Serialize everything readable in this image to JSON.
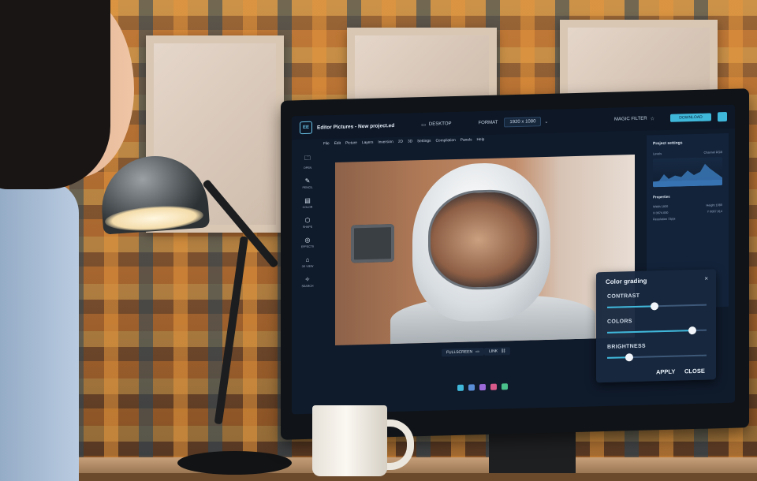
{
  "app": {
    "logo": "EE",
    "title": "Editor Pictures - New project.ed",
    "desktop_label": "DESKTOP",
    "format_label": "FORMAT",
    "format_value": "1920 x 1080",
    "magic_filter": "MAGIC FILTER",
    "download_label": "DOWNLOAD"
  },
  "menu": [
    "File",
    "Edit",
    "Picture",
    "Layers",
    "Inversion",
    "2D",
    "3D",
    "Settings",
    "Compilation",
    "Panels",
    "Help"
  ],
  "tools": [
    {
      "icon": "folder-icon",
      "glyph": "🗀",
      "label": "OPEN"
    },
    {
      "icon": "pencil-icon",
      "glyph": "✎",
      "label": "PENCIL"
    },
    {
      "icon": "palette-icon",
      "glyph": "▤",
      "label": "COLOR"
    },
    {
      "icon": "cube-icon",
      "glyph": "⬡",
      "label": "SHAPE"
    },
    {
      "icon": "glasses-icon",
      "glyph": "◎",
      "label": "EFFECTS"
    },
    {
      "icon": "home-icon",
      "glyph": "⌂",
      "label": "3D VIEW"
    },
    {
      "icon": "compass-icon",
      "glyph": "✧",
      "label": "SEARCH"
    }
  ],
  "photo_controls": {
    "fullscreen": "FULLSCREEN",
    "link": "LINK"
  },
  "project_settings": {
    "title": "Project settings",
    "levels": "Levels",
    "channel": "Channel",
    "channel_value": "RGB",
    "properties": "Properties",
    "width_row": "Width 1920",
    "height_row": "Height 1080",
    "x_row": "X 0074.000",
    "y_row": "Y 0087.914",
    "resolution": "Resolution 72ppi"
  },
  "color_grading": {
    "title": "Color grading",
    "contrast_label": "CONTRAST",
    "contrast": 0.48,
    "colors_label": "COLORS",
    "colors": 0.86,
    "brightness_label": "BRIGHTNESS",
    "brightness": 0.22,
    "apply": "APPLY",
    "close": "CLOSE",
    "close_glyph": "×"
  },
  "colors": {
    "accent": "#3fb7d9",
    "panel": "#13233a",
    "screen_bg": "#0f1a2b"
  },
  "dock_colors": [
    "#3fb7d9",
    "#5a8fd8",
    "#9a6ad8",
    "#d85a8a",
    "#4ac08a"
  ]
}
